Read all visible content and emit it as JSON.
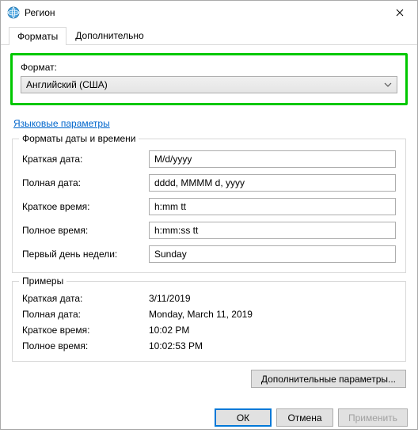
{
  "window": {
    "title": "Регион"
  },
  "tabs": {
    "formats": "Форматы",
    "additional": "Дополнительно"
  },
  "format": {
    "label": "Формат:",
    "value": "Английский (США)"
  },
  "link": {
    "language_params": "Языковые параметры"
  },
  "date_time_group": {
    "title": "Форматы даты и времени",
    "short_date_label": "Краткая дата:",
    "short_date_value": "M/d/yyyy",
    "long_date_label": "Полная дата:",
    "long_date_value": "dddd, MMMM d, yyyy",
    "short_time_label": "Краткое время:",
    "short_time_value": "h:mm tt",
    "long_time_label": "Полное время:",
    "long_time_value": "h:mm:ss tt",
    "first_day_label": "Первый день недели:",
    "first_day_value": "Sunday"
  },
  "examples_group": {
    "title": "Примеры",
    "short_date_label": "Краткая дата:",
    "short_date_value": "3/11/2019",
    "long_date_label": "Полная дата:",
    "long_date_value": "Monday, March 11, 2019",
    "short_time_label": "Краткое время:",
    "short_time_value": "10:02 PM",
    "long_time_label": "Полное время:",
    "long_time_value": "10:02:53 PM"
  },
  "buttons": {
    "additional_params": "Дополнительные параметры...",
    "ok": "ОК",
    "cancel": "Отмена",
    "apply": "Применить"
  }
}
